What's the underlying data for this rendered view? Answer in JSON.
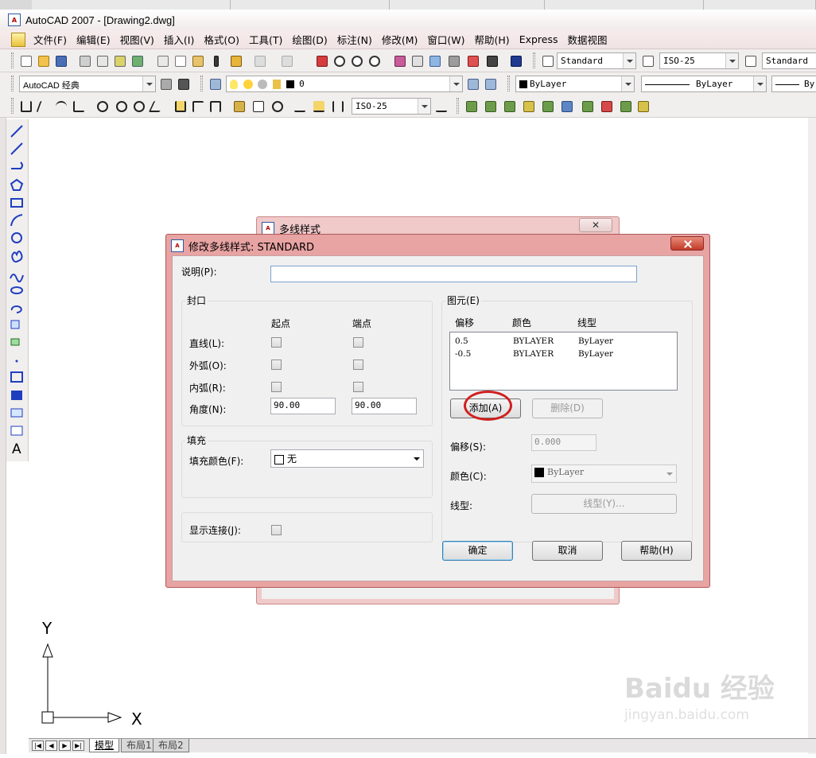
{
  "app": {
    "title": "AutoCAD 2007 - [Drawing2.dwg]",
    "icon_text": "A"
  },
  "menu": [
    "文件(F)",
    "编辑(E)",
    "视图(V)",
    "插入(I)",
    "格式(O)",
    "工具(T)",
    "绘图(D)",
    "标注(N)",
    "修改(M)",
    "窗口(W)",
    "帮助(H)",
    "Express",
    "数据视图"
  ],
  "toolbars": {
    "text_style": "Standard",
    "dim_style": "ISO-25",
    "table_style": "Standard",
    "workspace": "AutoCAD 经典",
    "layer": "0",
    "color": "ByLayer",
    "linetype": "ByLayer",
    "lineweight": "By",
    "dim_style_2": "ISO-25"
  },
  "background_dialog": {
    "title": "多线样式",
    "close_label": "✕"
  },
  "dialog": {
    "title": "修改多线样式: STANDARD",
    "description_label": "说明(P):",
    "description_value": "",
    "caps": {
      "title": "封口",
      "start_header": "起点",
      "end_header": "端点",
      "line_label": "直线(L):",
      "outer_arc_label": "外弧(O):",
      "inner_arc_label": "内弧(R):",
      "angle_label": "角度(N):",
      "start_angle": "90.00",
      "end_angle": "90.00"
    },
    "fill": {
      "title": "填充",
      "color_label": "填充颜色(F):",
      "color_value": "无"
    },
    "show_joints_label": "显示连接(J):",
    "elements": {
      "title": "图元(E)",
      "headers": [
        "偏移",
        "颜色",
        "线型"
      ],
      "rows": [
        {
          "offset": "0.5",
          "color": "BYLAYER",
          "linetype": "ByLayer"
        },
        {
          "offset": "-0.5",
          "color": "BYLAYER",
          "linetype": "ByLayer"
        }
      ],
      "add_button": "添加(A)",
      "delete_button": "删除(D)",
      "offset_label": "偏移(S):",
      "offset_value": "0.000",
      "color_label": "颜色(C):",
      "color_value": "ByLayer",
      "linetype_label": "线型:",
      "linetype_button": "线型(Y)..."
    },
    "ok_button": "确定",
    "cancel_button": "取消",
    "help_button": "帮助(H)"
  },
  "ucs": {
    "y_label": "Y",
    "x_label": "X"
  },
  "layout_tabs": [
    "模型",
    "布局1",
    "布局2"
  ],
  "watermark": {
    "logo": "Baidu 经验",
    "url": "jingyan.baidu.com"
  },
  "colors": {
    "accent_red": "#d11e1e",
    "dialog_frame": "#e8a3a3"
  }
}
